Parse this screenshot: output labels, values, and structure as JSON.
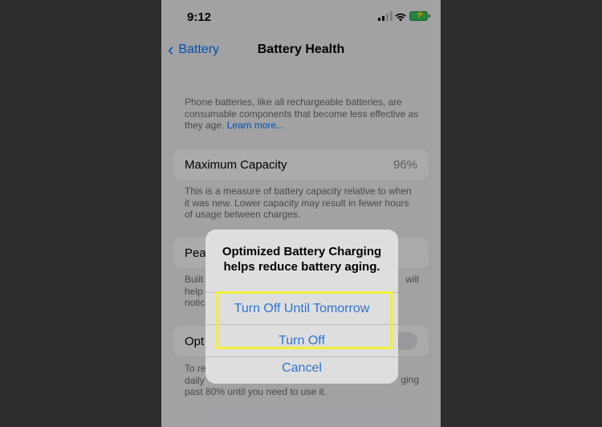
{
  "status_bar": {
    "time": "9:12",
    "icons": [
      "signal-icon",
      "wifi-icon",
      "battery-charging-icon"
    ]
  },
  "nav": {
    "back_label": "Battery",
    "title": "Battery Health"
  },
  "intro": {
    "text": "Phone batteries, like all rechargeable batteries, are consumable components that become less effective as they age.",
    "link": "Learn more..."
  },
  "max_capacity": {
    "label": "Maximum Capacity",
    "value": "96%",
    "footnote": "This is a measure of battery capacity relative to when it was new. Lower capacity may result in fewer hours of usage between charges."
  },
  "peak_performance": {
    "label_visible": "Pea",
    "footnote_line1": "Built",
    "footnote_line1_right": "will",
    "footnote_line2": "help",
    "footnote_line3": "notic"
  },
  "optimized_charging_row": {
    "label_visible": "Opt"
  },
  "optimized_footnote": {
    "line1": "To re",
    "line2_left": "daily",
    "line2_right": "ging",
    "line3": "past 80% until you need to use it."
  },
  "alert": {
    "title": "Optimized Battery Charging helps reduce battery aging.",
    "buttons": [
      "Turn Off Until Tomorrow",
      "Turn Off",
      "Cancel"
    ]
  },
  "colors": {
    "accent": "#007aff",
    "highlight": "#f1ee3a",
    "charging": "#34c759"
  }
}
